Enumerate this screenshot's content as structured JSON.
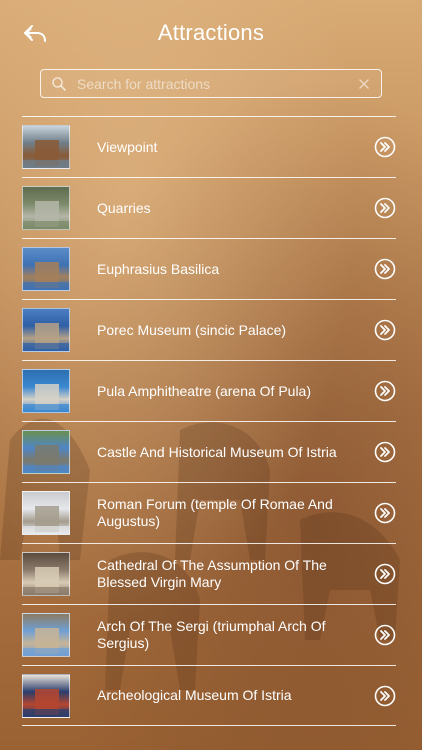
{
  "header": {
    "title": "Attractions",
    "back_icon": "back-arrow-icon"
  },
  "search": {
    "placeholder": "Search for attractions",
    "value": "",
    "icon": "search-icon",
    "clear_icon": "close-icon"
  },
  "attractions": [
    {
      "label": "Viewpoint",
      "thumb_colors": [
        "#6f7f8a",
        "#8a5a36",
        "#c9d3dc"
      ]
    },
    {
      "label": "Quarries",
      "thumb_colors": [
        "#7c8a6a",
        "#b4b6a7",
        "#5f6c4f"
      ]
    },
    {
      "label": "Euphrasius Basilica",
      "thumb_colors": [
        "#3f72b4",
        "#a47f5a",
        "#5a8cc8"
      ]
    },
    {
      "label": "Porec Museum (sincic Palace)",
      "thumb_colors": [
        "#2f5fa5",
        "#b5a186",
        "#4b7ec2"
      ]
    },
    {
      "label": "Pula Amphitheatre (arena Of Pula)",
      "thumb_colors": [
        "#3b88d1",
        "#d6d1c7",
        "#2d6fb0"
      ]
    },
    {
      "label": "Castle And Historical Museum Of Istria",
      "thumb_colors": [
        "#4f86c6",
        "#7b7a6d",
        "#6a8f4f"
      ]
    },
    {
      "label": "Roman Forum (temple Of Romae And Augustus)",
      "thumb_colors": [
        "#e6e8ec",
        "#a59d8e",
        "#c9cbcf"
      ]
    },
    {
      "label": "Cathedral Of The Assumption Of The Blessed Virgin Mary",
      "thumb_colors": [
        "#8a7a6a",
        "#d8cbb5",
        "#5b4c3f"
      ]
    },
    {
      "label": "Arch Of The Sergi (triumphal Arch Of Sergius)",
      "thumb_colors": [
        "#6fa0d6",
        "#c7b496",
        "#8b7b63"
      ]
    },
    {
      "label": "Archeological Museum Of Istria",
      "thumb_colors": [
        "#2a3e6e",
        "#b5462f",
        "#e8e2d6"
      ]
    }
  ],
  "row_icon": "chevron-double-right-icon"
}
